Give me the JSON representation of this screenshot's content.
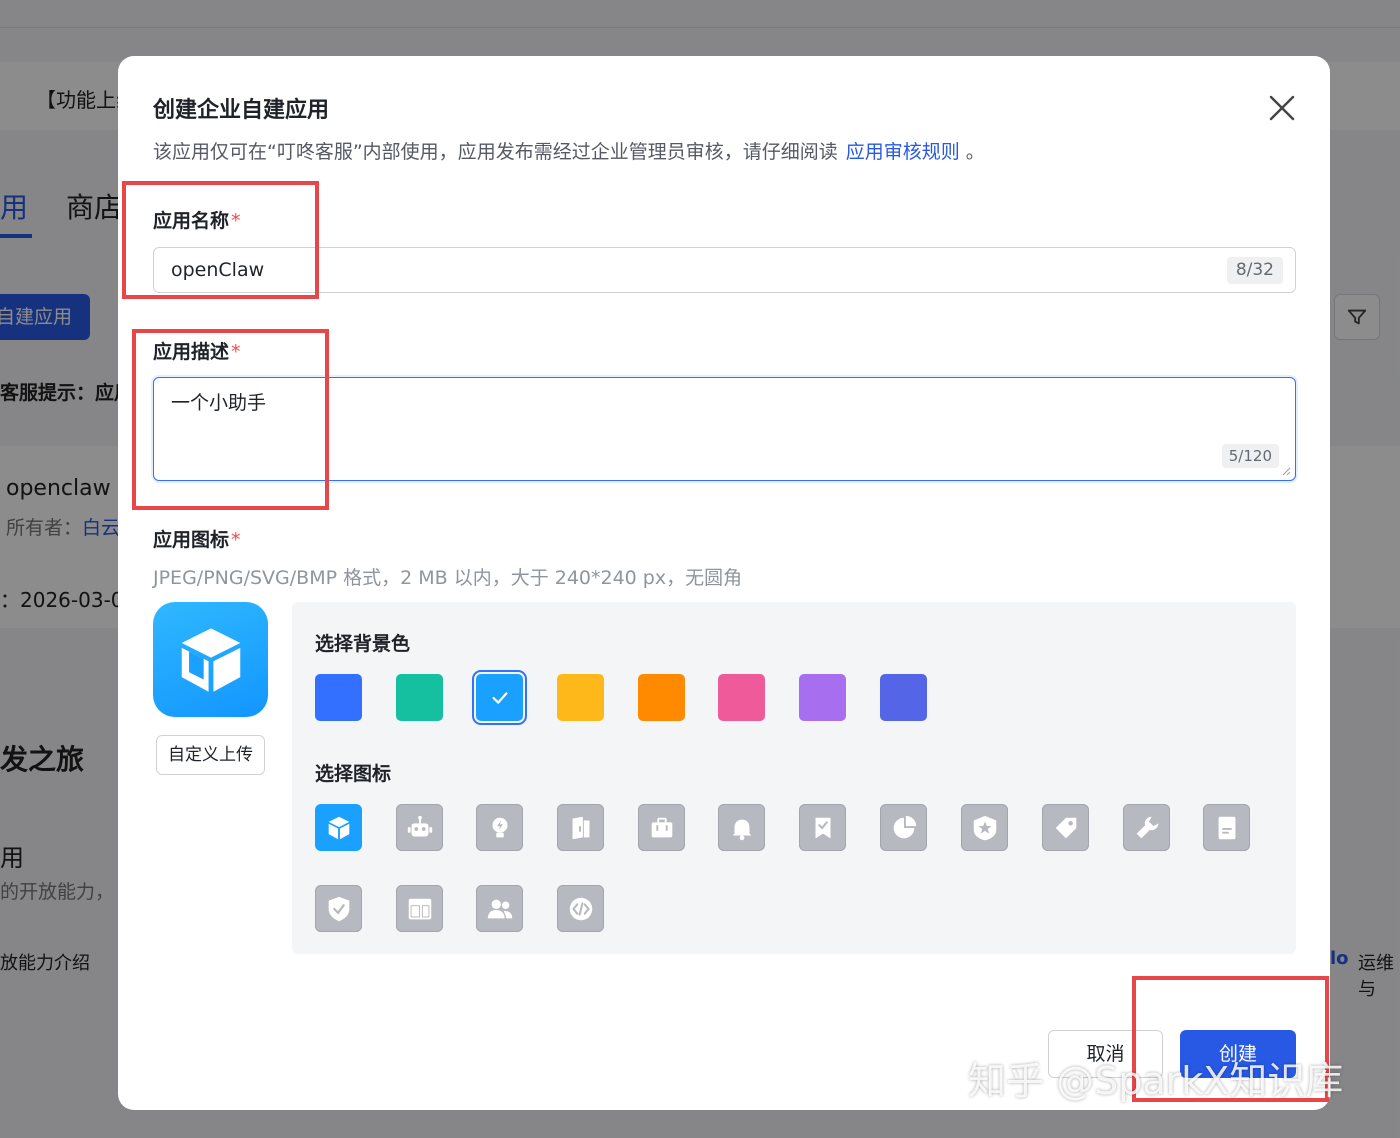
{
  "background": {
    "notice": "【功能上线",
    "tabs": [
      "用",
      "商店"
    ],
    "create_button": "自建应用",
    "hint": "客服提示：应用",
    "app": {
      "name": "openclaw",
      "owner_label": "所有者：",
      "owner_value": "白云",
      "date": "：2026-03-0"
    },
    "journey": "发之旅",
    "section": "用",
    "open_capability": "的开放能力，",
    "intro": "放能力介绍",
    "ops": "运维与"
  },
  "modal": {
    "title": "创建企业自建应用",
    "subtitle": "该应用仅可在“叮咚客服”内部使用，应用发布需经过企业管理员审核，请仔细阅读",
    "subtitle_link": "应用审核规则",
    "subtitle_end": "。",
    "name_field": {
      "label": "应用名称",
      "required": "*",
      "value": "openClaw",
      "counter": "8/32"
    },
    "desc_field": {
      "label": "应用描述",
      "required": "*",
      "value": "一个小助手",
      "counter": "5/120"
    },
    "icon_field": {
      "label": "应用图标",
      "required": "*",
      "hint": "JPEG/PNG/SVG/BMP 格式，2 MB 以内，大于 240*240 px，无圆角"
    },
    "upload_button": "自定义上传",
    "bg_color_label": "选择背景色",
    "bg_colors": [
      "#3370ff",
      "#14c0a0",
      "#1aa1ff",
      "#ffb81a",
      "#ff8a00",
      "#ef5a9a",
      "#a86ef0",
      "#5465e8"
    ],
    "selected_color_index": 2,
    "icon_label": "选择图标",
    "icons": [
      "cube-icon",
      "robot-icon",
      "bulb-icon",
      "book-icon",
      "briefcase-icon",
      "bell-icon",
      "bookmark-check-icon",
      "pie-chart-icon",
      "star-badge-icon",
      "tag-icon",
      "wrench-icon",
      "document-icon",
      "shield-check-icon",
      "layout-icon",
      "users-icon",
      "code-icon"
    ],
    "selected_icon_index": 0,
    "cancel_button": "取消",
    "create_button": "创建"
  },
  "watermark": "知乎 @SparkX知识库"
}
